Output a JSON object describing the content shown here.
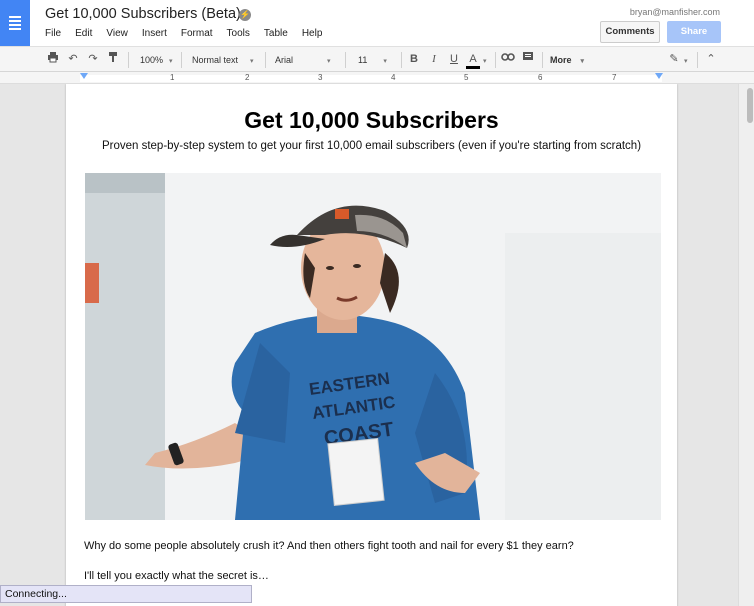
{
  "header": {
    "title": "Get 10,000 Subscribers (Beta)",
    "beta_icon": "lightning-icon",
    "user_email": "bryan@manfisher.com",
    "comments_label": "Comments",
    "share_label": "Share"
  },
  "menu": [
    "File",
    "Edit",
    "View",
    "Insert",
    "Format",
    "Tools",
    "Table",
    "Help"
  ],
  "toolbar": {
    "zoom": "100%",
    "style": "Normal text",
    "font": "Arial",
    "size": "11",
    "bold": "B",
    "italic": "I",
    "underline": "U",
    "text_color": "A",
    "more": "More"
  },
  "ruler": [
    "1",
    "2",
    "3",
    "4",
    "5",
    "6",
    "7"
  ],
  "document": {
    "heading": "Get 10,000 Subscribers",
    "subheading": "Proven step-by-step system to get your first 10,000 email subscribers (even if you're starting from scratch)",
    "para1": "Why do some people absolutely crush it? And then others fight tooth and nail for every $1 they earn?",
    "para2": "I'll tell you exactly what the secret is…"
  },
  "status": "Connecting...",
  "colors": {
    "brand_blue": "#4285f4",
    "share_blue": "#a7c5f9",
    "shirt_blue": "#2f6fb0"
  }
}
